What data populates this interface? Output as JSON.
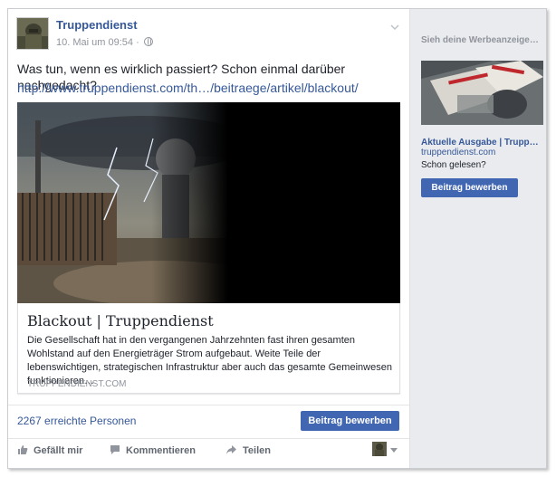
{
  "post": {
    "page_name": "Truppendienst",
    "timestamp": "10. Mai um 09:54",
    "separator": "·",
    "text": "Was tun, wenn es wirklich passiert? Schon einmal darüber nachgedacht?",
    "link": "http://www.truppendienst.com/th…/beitraege/artikel/blackout/",
    "card": {
      "title": "Blackout | Truppendienst",
      "description": "Die Gesellschaft hat in den vergangenen Jahrzehnten fast ihren gesamten Wohlstand auf den Energieträger Strom aufgebaut. Weite Teile der lebenswichtigen, strategischen Infrastruktur aber auch das gesamte Gemeinwesen funktionieren…",
      "domain": "TRUPPENDIENST.COM"
    },
    "reach": "2267 erreichte Personen",
    "boost_label": "Beitrag bewerben",
    "actions": {
      "like": "Gefällt mir",
      "comment": "Kommentieren",
      "share": "Teilen"
    }
  },
  "rail": {
    "heading": "Sieh deine Werbeanzeige…",
    "ad_title": "Aktuelle Ausgabe | Trupp…",
    "ad_domain": "truppendienst.com",
    "ad_text": "Schon gelesen?",
    "ad_button": "Beitrag bewerben"
  },
  "colors": {
    "link": "#365899",
    "button": "#4267b2",
    "rail_bg": "#e9ebee"
  }
}
